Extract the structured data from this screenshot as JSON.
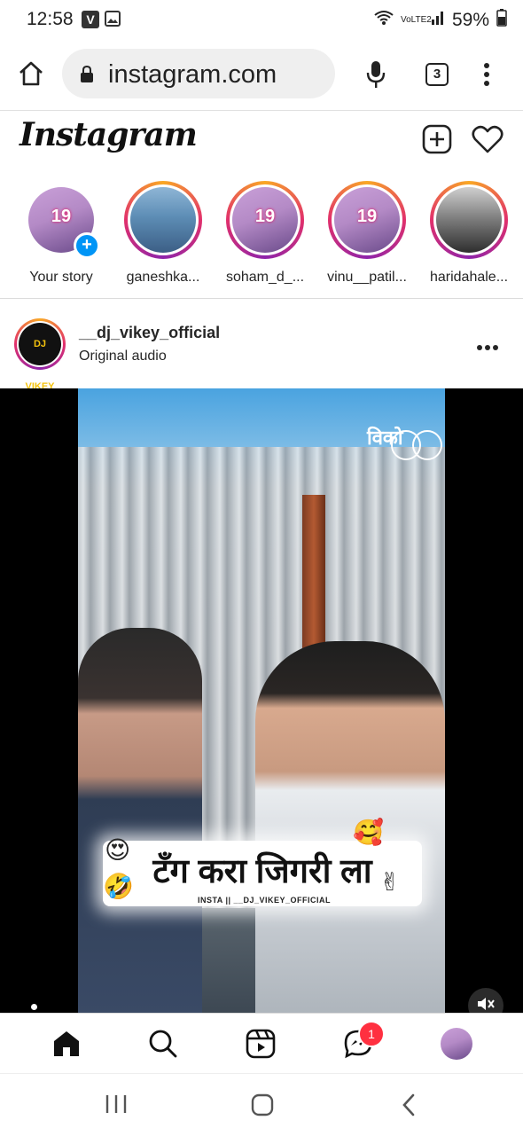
{
  "status_bar": {
    "time": "12:58",
    "badge_v": "V",
    "network": "VoLTE2",
    "battery": "59%"
  },
  "browser": {
    "url": "instagram.com",
    "tab_count": "3",
    "icons": [
      "home-icon",
      "lock-icon",
      "mic-icon",
      "tabs-icon",
      "more-vert-icon"
    ]
  },
  "ig_header": {
    "logo": "Instagram",
    "icons": [
      "new-post-icon",
      "heart-icon"
    ]
  },
  "stories": [
    {
      "label": "Your story",
      "avatar_text": "19"
    },
    {
      "label": "ganeshka..."
    },
    {
      "label": "soham_d_...",
      "avatar_text": "19"
    },
    {
      "label": "vinu__patil...",
      "avatar_text": "19"
    },
    {
      "label": "haridahale..."
    }
  ],
  "post": {
    "username": "__dj_vikey_official",
    "audio": "Original audio",
    "avatar_text": "DJ VIKEY",
    "video": {
      "caption": "टँग करा जिगरी ला",
      "watermark_small": "INSTA || __DJ_VIKEY_OFFICIAL",
      "corner_mark": "विको",
      "emojis": [
        "😍",
        "🤣",
        "🥰",
        "✌"
      ]
    }
  },
  "bottom_nav": {
    "notification_count": "1",
    "icons": [
      "home-icon",
      "search-icon",
      "reels-icon",
      "messenger-icon",
      "profile-avatar"
    ]
  },
  "colors": {
    "accent": "#0095f6",
    "notif": "#ff3040",
    "text": "#262626"
  }
}
